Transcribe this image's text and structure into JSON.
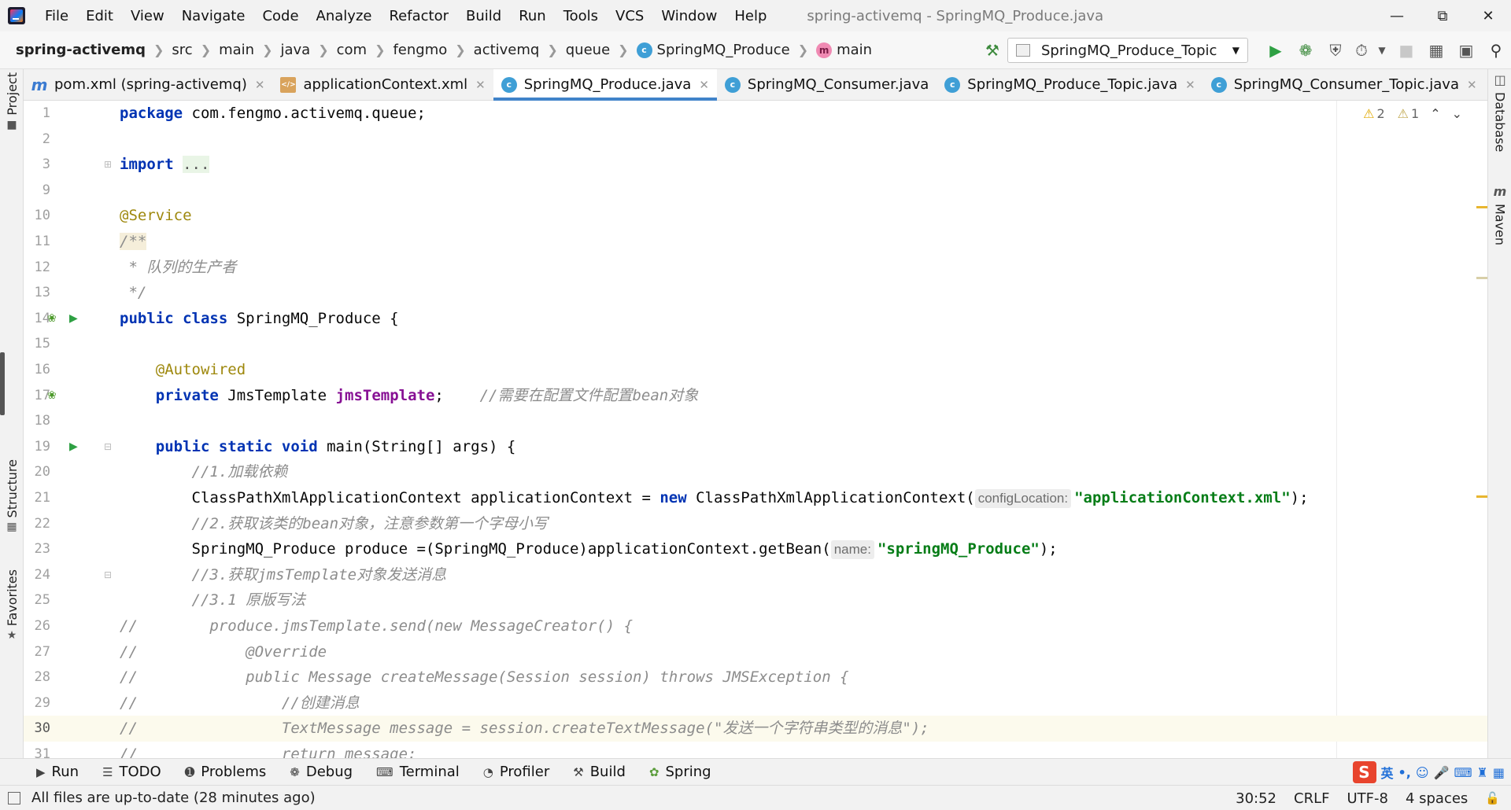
{
  "menubar": {
    "items": [
      {
        "label": "File"
      },
      {
        "label": "Edit"
      },
      {
        "label": "View"
      },
      {
        "label": "Navigate"
      },
      {
        "label": "Code"
      },
      {
        "label": "Analyze"
      },
      {
        "label": "Refactor"
      },
      {
        "label": "Build"
      },
      {
        "label": "Run"
      },
      {
        "label": "Tools"
      },
      {
        "label": "VCS"
      },
      {
        "label": "Window"
      },
      {
        "label": "Help"
      }
    ],
    "window_title": "spring-activemq - SpringMQ_Produce.java"
  },
  "breadcrumbs": [
    "spring-activemq",
    "src",
    "main",
    "java",
    "com",
    "fengmo",
    "activemq",
    "queue",
    "SpringMQ_Produce",
    "main"
  ],
  "run_config": {
    "name": "SpringMQ_Produce_Topic"
  },
  "left_tools": {
    "project": "Project",
    "structure": "Structure",
    "favorites": "Favorites"
  },
  "right_tools": {
    "database": "Database",
    "maven": "Maven"
  },
  "tabs": [
    {
      "label": "pom.xml (spring-activemq)",
      "icon": "maven-icon"
    },
    {
      "label": "applicationContext.xml",
      "icon": "xml-file-icon"
    },
    {
      "label": "SpringMQ_Produce.java",
      "icon": "java-class-icon",
      "active": true
    },
    {
      "label": "SpringMQ_Consumer.java",
      "icon": "java-class-icon"
    },
    {
      "label": "SpringMQ_Produce_Topic.java",
      "icon": "java-class-icon"
    },
    {
      "label": "SpringMQ_Consumer_Topic.java",
      "icon": "java-class-icon"
    }
  ],
  "inspections": {
    "warnings": "2",
    "weak_warnings": "1"
  },
  "editor": {
    "current_line": "30",
    "lines": [
      {
        "num": "1"
      },
      {
        "num": "2"
      },
      {
        "num": "3"
      },
      {
        "num": "9"
      },
      {
        "num": "10"
      },
      {
        "num": "11"
      },
      {
        "num": "12"
      },
      {
        "num": "13"
      },
      {
        "num": "14"
      },
      {
        "num": "15"
      },
      {
        "num": "16"
      },
      {
        "num": "17"
      },
      {
        "num": "18"
      },
      {
        "num": "19"
      },
      {
        "num": "20"
      },
      {
        "num": "21"
      },
      {
        "num": "22"
      },
      {
        "num": "23"
      },
      {
        "num": "24"
      },
      {
        "num": "25"
      },
      {
        "num": "26"
      },
      {
        "num": "27"
      },
      {
        "num": "28"
      },
      {
        "num": "29"
      },
      {
        "num": "30"
      },
      {
        "num": "31"
      }
    ],
    "code": {
      "l1_kw": "package",
      "l1_rest": " com.fengmo.activemq.queue;",
      "l3_kw": "import",
      "l3_fold": "...",
      "l10": "@Service",
      "l11": "/**",
      "l12": " * 队列的生产者",
      "l13": " */",
      "l14_kw": "public class",
      "l14_rest": " SpringMQ_Produce {",
      "l16": "@Autowired",
      "l17_kw": "private",
      "l17_type": " JmsTemplate ",
      "l17_field": "jmsTemplate",
      "l17_semi": ";    ",
      "l17_cmt": "//需要在配置文件配置bean对象",
      "l19_kw": "public static void",
      "l19_rest": " main(String[] args) {",
      "l20": "//1.加载依赖",
      "l21_a": "ClassPathXmlApplicationContext applicationContext = ",
      "l21_kw": "new",
      "l21_b": " ClassPathXmlApplicationContext(",
      "l21_hint": "configLocation:",
      "l21_str": "\"applicationContext.xml\"",
      "l21_end": ");",
      "l22": "//2.获取该类的bean对象，注意参数第一个字母小写",
      "l23_a": "SpringMQ_Produce produce =(SpringMQ_Produce)applicationContext.getBean(",
      "l23_hint": "name:",
      "l23_str": "\"springMQ_Produce\"",
      "l23_end": ");",
      "l24": "//3.获取jmsTemplate对象发送消息",
      "l25": "//3.1 原版写法",
      "l26": "//        produce.jmsTemplate.send(new MessageCreator() {",
      "l27": "//            @Override",
      "l28": "//            public Message createMessage(Session session) throws JMSException {",
      "l29": "//                //创建消息",
      "l30": "//                TextMessage message = session.createTextMessage(\"发送一个字符串类型的消息\");",
      "l31": "//                return message;"
    }
  },
  "bottom_tools": [
    {
      "label": "Run",
      "icon": "run-icon"
    },
    {
      "label": "TODO",
      "icon": "todo-icon"
    },
    {
      "label": "Problems",
      "icon": "problems-icon"
    },
    {
      "label": "Debug",
      "icon": "debug-icon"
    },
    {
      "label": "Terminal",
      "icon": "terminal-icon"
    },
    {
      "label": "Profiler",
      "icon": "profiler-icon"
    },
    {
      "label": "Build",
      "icon": "hammer-icon"
    },
    {
      "label": "Spring",
      "icon": "spring-leaf-icon"
    }
  ],
  "ime": {
    "lang": "英",
    "punct": "•,"
  },
  "status": {
    "message": "All files are up-to-date (28 minutes ago)",
    "position": "30:52",
    "line_sep": "CRLF",
    "encoding": "UTF-8",
    "indent": "4 spaces"
  },
  "colors": {
    "accent": "#4083c9",
    "keyword": "#0033b3",
    "annotation": "#9e880d",
    "string": "#067d17",
    "comment": "#8c8c8c",
    "field": "#871094"
  }
}
